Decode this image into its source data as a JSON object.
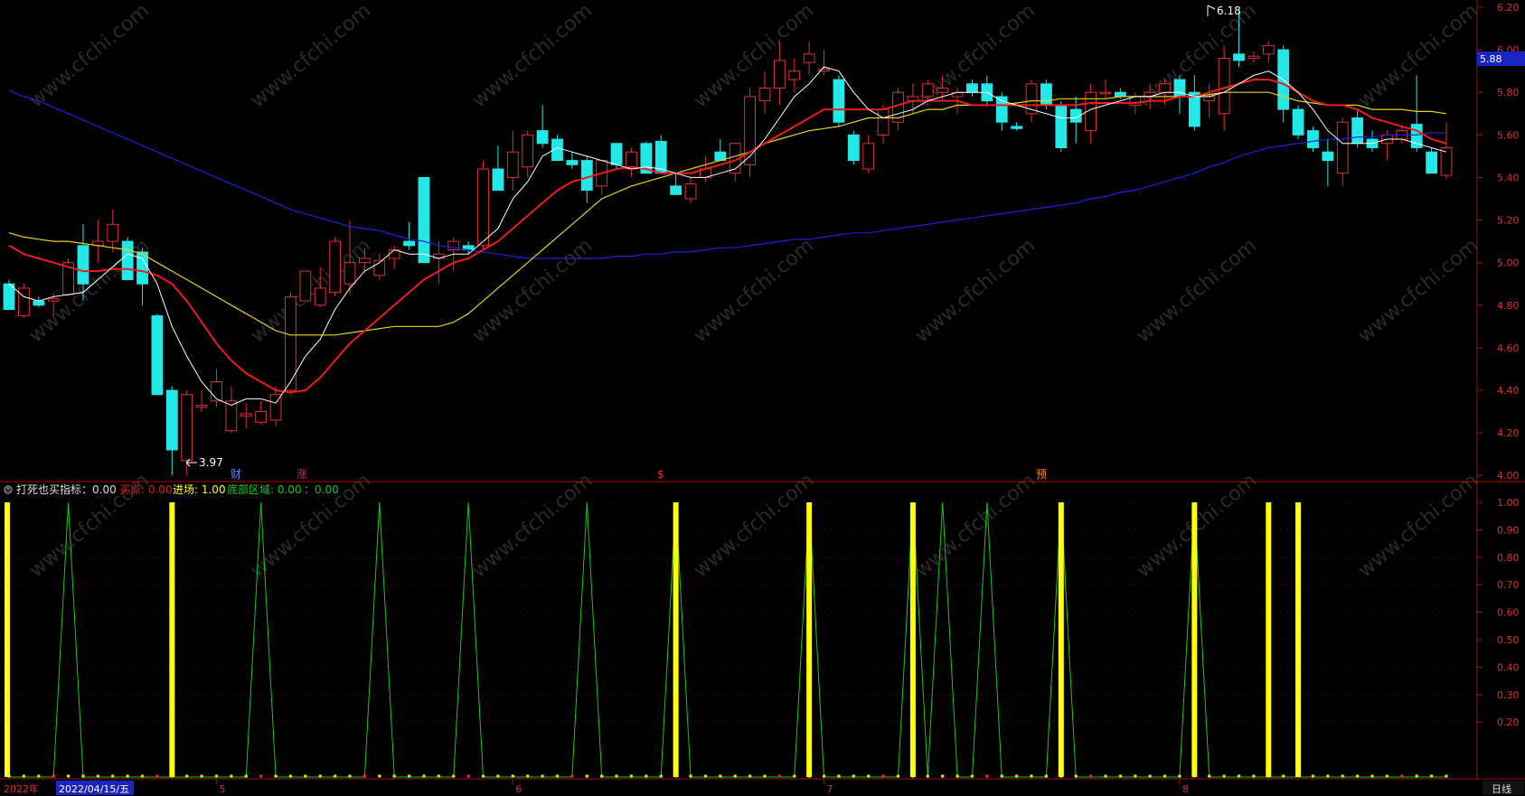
{
  "colors": {
    "background": "#000000",
    "axis": "#a01010",
    "up_candle": "#e03030",
    "down_candle": "#22e8e8",
    "ma5": "#ffffff",
    "ma10": "#ee1c1c",
    "ma20": "#e6d21a",
    "ma60": "#1a24d8",
    "signal_line": "#18c818",
    "entry_bar": "#ffff00",
    "price_tag_bg": "#1a24c0"
  },
  "header": {
    "indicator_title": "打死也买指标：0.00",
    "buy_label": "买点: 0.00",
    "entry_label": "进场: 1.00",
    "bottom_label": "底部区域: 0.00",
    "extra_label": "：0.00"
  },
  "price_axis_labels": [
    "6.00",
    "5.80",
    "5.60",
    "5.40",
    "5.20",
    "5.00",
    "4.80",
    "4.60",
    "4.40",
    "4.20",
    "4.00"
  ],
  "price_axis_top_partial": "6.20",
  "indicator_axis_labels": [
    "1.00",
    "0.90",
    "0.80",
    "0.70",
    "0.60",
    "0.50",
    "0.40",
    "0.30",
    "0.20"
  ],
  "current_price_tag": "5.88",
  "high_label": "6.18",
  "low_label": "3.97",
  "event_markers": [
    "财",
    "涨",
    "$",
    "预"
  ],
  "bottom_bar": {
    "year_label": "2022年",
    "date_label": "2022/04/15/五",
    "months": [
      "5",
      "6",
      "7",
      "8"
    ],
    "period_button": "日线"
  },
  "chart_data": {
    "type": "candlestick",
    "ylim": [
      3.95,
      6.2
    ],
    "y2lim": [
      0,
      1
    ],
    "candles": [
      [
        4.9,
        4.92,
        4.78,
        4.78
      ],
      [
        4.75,
        4.9,
        4.74,
        4.88
      ],
      [
        4.82,
        4.84,
        4.79,
        4.8
      ],
      [
        4.82,
        4.86,
        4.75,
        4.83
      ],
      [
        4.85,
        5.02,
        4.84,
        5.0
      ],
      [
        5.08,
        5.18,
        4.82,
        4.9
      ],
      [
        5.08,
        5.2,
        5.0,
        5.1
      ],
      [
        5.1,
        5.25,
        5.05,
        5.18
      ],
      [
        5.1,
        5.12,
        4.92,
        4.92
      ],
      [
        5.05,
        5.07,
        4.8,
        4.9
      ],
      [
        4.75,
        4.76,
        4.38,
        4.38
      ],
      [
        4.4,
        4.42,
        4.0,
        4.12
      ],
      [
        4.07,
        4.4,
        4.0,
        4.38
      ],
      [
        4.32,
        4.4,
        4.3,
        4.33
      ],
      [
        4.35,
        4.5,
        4.32,
        4.44
      ],
      [
        4.21,
        4.42,
        4.2,
        4.35
      ],
      [
        4.28,
        4.34,
        4.22,
        4.29
      ],
      [
        4.25,
        4.35,
        4.24,
        4.3
      ],
      [
        4.26,
        4.42,
        4.23,
        4.38
      ],
      [
        4.4,
        4.86,
        4.38,
        4.84
      ],
      [
        4.82,
        4.83,
        4.94,
        4.96
      ],
      [
        4.8,
        4.98,
        4.79,
        4.88
      ],
      [
        4.86,
        5.12,
        4.84,
        5.1
      ],
      [
        4.9,
        5.2,
        4.85,
        5.0
      ],
      [
        5.0,
        5.07,
        4.96,
        5.02
      ],
      [
        4.94,
        5.04,
        4.92,
        5.01
      ],
      [
        5.02,
        5.08,
        4.97,
        5.06
      ],
      [
        5.1,
        5.19,
        5.06,
        5.08
      ],
      [
        5.4,
        5.4,
        5.0,
        5.0
      ],
      [
        5.02,
        5.1,
        4.9,
        5.04
      ],
      [
        5.06,
        5.12,
        4.96,
        5.1
      ],
      [
        5.08,
        5.1,
        5.04,
        5.06
      ],
      [
        5.08,
        5.48,
        5.06,
        5.44
      ],
      [
        5.44,
        5.55,
        5.36,
        5.34
      ],
      [
        5.4,
        5.62,
        5.34,
        5.52
      ],
      [
        5.45,
        5.62,
        5.4,
        5.6
      ],
      [
        5.62,
        5.74,
        5.54,
        5.56
      ],
      [
        5.58,
        5.6,
        5.48,
        5.48
      ],
      [
        5.48,
        5.52,
        5.44,
        5.46
      ],
      [
        5.48,
        5.5,
        5.28,
        5.34
      ],
      [
        5.36,
        5.48,
        5.32,
        5.48
      ],
      [
        5.56,
        5.56,
        5.44,
        5.46
      ],
      [
        5.44,
        5.54,
        5.4,
        5.52
      ],
      [
        5.56,
        5.57,
        5.42,
        5.42
      ],
      [
        5.57,
        5.6,
        5.5,
        5.42
      ],
      [
        5.36,
        5.42,
        5.33,
        5.32
      ],
      [
        5.3,
        5.4,
        5.28,
        5.37
      ],
      [
        5.4,
        5.5,
        5.38,
        5.44
      ],
      [
        5.52,
        5.58,
        5.48,
        5.48
      ],
      [
        5.42,
        5.56,
        5.38,
        5.56
      ],
      [
        5.46,
        5.82,
        5.4,
        5.78
      ],
      [
        5.76,
        5.9,
        5.7,
        5.82
      ],
      [
        5.82,
        6.04,
        5.74,
        5.95
      ],
      [
        5.86,
        5.96,
        5.8,
        5.9
      ],
      [
        5.94,
        6.04,
        5.88,
        5.98
      ],
      [
        5.9,
        6.0,
        5.88,
        5.91
      ],
      [
        5.86,
        5.88,
        5.64,
        5.66
      ],
      [
        5.6,
        5.62,
        5.46,
        5.48
      ],
      [
        5.44,
        5.6,
        5.42,
        5.56
      ],
      [
        5.6,
        5.74,
        5.56,
        5.72
      ],
      [
        5.66,
        5.82,
        5.62,
        5.8
      ],
      [
        5.76,
        5.84,
        5.7,
        5.78
      ],
      [
        5.78,
        5.86,
        5.74,
        5.84
      ],
      [
        5.8,
        5.88,
        5.76,
        5.82
      ],
      [
        5.78,
        5.82,
        5.7,
        5.8
      ],
      [
        5.84,
        5.86,
        5.78,
        5.8
      ],
      [
        5.84,
        5.88,
        5.74,
        5.76
      ],
      [
        5.78,
        5.8,
        5.62,
        5.66
      ],
      [
        5.64,
        5.66,
        5.62,
        5.63
      ],
      [
        5.7,
        5.86,
        5.66,
        5.84
      ],
      [
        5.84,
        5.86,
        5.72,
        5.74
      ],
      [
        5.74,
        5.76,
        5.52,
        5.54
      ],
      [
        5.72,
        5.78,
        5.56,
        5.66
      ],
      [
        5.62,
        5.84,
        5.56,
        5.8
      ],
      [
        5.8,
        5.86,
        5.77,
        5.8
      ],
      [
        5.8,
        5.82,
        5.77,
        5.78
      ],
      [
        5.74,
        5.8,
        5.7,
        5.78
      ],
      [
        5.78,
        5.84,
        5.72,
        5.8
      ],
      [
        5.8,
        5.86,
        5.74,
        5.84
      ],
      [
        5.86,
        5.88,
        5.7,
        5.78
      ],
      [
        5.8,
        5.88,
        5.62,
        5.64
      ],
      [
        5.76,
        5.84,
        5.68,
        5.78
      ],
      [
        5.7,
        6.02,
        5.62,
        5.96
      ],
      [
        5.98,
        6.18,
        5.92,
        5.95
      ],
      [
        5.96,
        5.99,
        5.94,
        5.97
      ],
      [
        5.98,
        6.04,
        5.94,
        6.02
      ],
      [
        6.0,
        6.02,
        5.66,
        5.72
      ],
      [
        5.72,
        5.74,
        5.58,
        5.6
      ],
      [
        5.62,
        5.64,
        5.52,
        5.54
      ],
      [
        5.52,
        5.58,
        5.36,
        5.48
      ],
      [
        5.42,
        5.68,
        5.36,
        5.66
      ],
      [
        5.68,
        5.72,
        5.54,
        5.56
      ],
      [
        5.58,
        5.62,
        5.52,
        5.54
      ],
      [
        5.56,
        5.62,
        5.48,
        5.6
      ],
      [
        5.58,
        5.64,
        5.56,
        5.62
      ],
      [
        5.65,
        5.88,
        5.52,
        5.54
      ],
      [
        5.52,
        5.54,
        5.42,
        5.42
      ],
      [
        5.41,
        5.66,
        5.39,
        5.54
      ]
    ],
    "ma5": [
      4.9,
      4.84,
      4.82,
      4.84,
      4.85,
      4.86,
      4.92,
      4.98,
      5.04,
      5.02,
      4.9,
      4.7,
      4.56,
      4.44,
      4.36,
      4.33,
      4.36,
      4.36,
      4.34,
      4.44,
      4.56,
      4.64,
      4.78,
      4.88,
      4.96,
      5.0,
      5.06,
      5.04,
      5.04,
      5.02,
      5.04,
      5.04,
      5.1,
      5.16,
      5.3,
      5.38,
      5.5,
      5.54,
      5.52,
      5.5,
      5.48,
      5.46,
      5.44,
      5.45,
      5.44,
      5.42,
      5.4,
      5.4,
      5.42,
      5.44,
      5.5,
      5.58,
      5.68,
      5.78,
      5.84,
      5.92,
      5.9,
      5.8,
      5.72,
      5.68,
      5.7,
      5.72,
      5.76,
      5.78,
      5.8,
      5.8,
      5.8,
      5.76,
      5.74,
      5.72,
      5.7,
      5.68,
      5.68,
      5.72,
      5.74,
      5.76,
      5.78,
      5.78,
      5.8,
      5.8,
      5.78,
      5.78,
      5.8,
      5.84,
      5.88,
      5.9,
      5.86,
      5.8,
      5.72,
      5.62,
      5.56,
      5.56,
      5.56,
      5.58,
      5.58,
      5.56,
      5.54,
      5.52
    ],
    "ma10": [
      5.08,
      5.04,
      5.02,
      5.0,
      4.98,
      4.96,
      4.96,
      4.97,
      4.97,
      4.96,
      4.94,
      4.9,
      4.82,
      4.72,
      4.62,
      4.54,
      4.48,
      4.44,
      4.4,
      4.39,
      4.4,
      4.46,
      4.54,
      4.62,
      4.68,
      4.74,
      4.8,
      4.86,
      4.92,
      4.96,
      5.0,
      5.02,
      5.06,
      5.1,
      5.16,
      5.22,
      5.28,
      5.34,
      5.38,
      5.4,
      5.42,
      5.44,
      5.45,
      5.44,
      5.42,
      5.42,
      5.42,
      5.44,
      5.46,
      5.48,
      5.52,
      5.56,
      5.6,
      5.64,
      5.68,
      5.72,
      5.72,
      5.72,
      5.72,
      5.72,
      5.74,
      5.76,
      5.76,
      5.76,
      5.76,
      5.74,
      5.74,
      5.74,
      5.74,
      5.74,
      5.74,
      5.74,
      5.74,
      5.75,
      5.75,
      5.75,
      5.75,
      5.76,
      5.76,
      5.78,
      5.78,
      5.8,
      5.82,
      5.84,
      5.86,
      5.86,
      5.84,
      5.8,
      5.76,
      5.74,
      5.74,
      5.72,
      5.68,
      5.66,
      5.64,
      5.62,
      5.58,
      5.56
    ],
    "ma20": [
      5.14,
      5.12,
      5.11,
      5.1,
      5.1,
      5.09,
      5.08,
      5.07,
      5.06,
      5.04,
      5.0,
      4.96,
      4.92,
      4.88,
      4.84,
      4.8,
      4.76,
      4.72,
      4.68,
      4.66,
      4.66,
      4.66,
      4.66,
      4.67,
      4.68,
      4.69,
      4.7,
      4.7,
      4.7,
      4.7,
      4.72,
      4.76,
      4.82,
      4.88,
      4.94,
      5.0,
      5.06,
      5.12,
      5.18,
      5.24,
      5.3,
      5.33,
      5.36,
      5.38,
      5.4,
      5.42,
      5.44,
      5.46,
      5.48,
      5.5,
      5.52,
      5.56,
      5.58,
      5.6,
      5.62,
      5.63,
      5.64,
      5.66,
      5.68,
      5.68,
      5.68,
      5.7,
      5.72,
      5.72,
      5.74,
      5.74,
      5.74,
      5.74,
      5.75,
      5.76,
      5.76,
      5.77,
      5.77,
      5.77,
      5.77,
      5.78,
      5.78,
      5.78,
      5.78,
      5.78,
      5.78,
      5.79,
      5.8,
      5.8,
      5.8,
      5.8,
      5.78,
      5.76,
      5.75,
      5.74,
      5.74,
      5.74,
      5.72,
      5.72,
      5.72,
      5.71,
      5.71,
      5.7
    ],
    "ma60": [
      5.81,
      5.78,
      5.76,
      5.73,
      5.7,
      5.67,
      5.64,
      5.61,
      5.58,
      5.55,
      5.52,
      5.49,
      5.46,
      5.43,
      5.4,
      5.37,
      5.34,
      5.31,
      5.28,
      5.25,
      5.23,
      5.21,
      5.19,
      5.17,
      5.16,
      5.15,
      5.13,
      5.11,
      5.1,
      5.08,
      5.07,
      5.06,
      5.05,
      5.04,
      5.03,
      5.02,
      5.02,
      5.02,
      5.02,
      5.02,
      5.02,
      5.03,
      5.03,
      5.04,
      5.04,
      5.05,
      5.05,
      5.06,
      5.07,
      5.07,
      5.08,
      5.09,
      5.1,
      5.11,
      5.11,
      5.12,
      5.13,
      5.14,
      5.14,
      5.15,
      5.16,
      5.17,
      5.18,
      5.19,
      5.2,
      5.21,
      5.22,
      5.23,
      5.24,
      5.25,
      5.26,
      5.27,
      5.28,
      5.3,
      5.31,
      5.33,
      5.34,
      5.36,
      5.38,
      5.4,
      5.42,
      5.45,
      5.47,
      5.5,
      5.52,
      5.54,
      5.55,
      5.56,
      5.57,
      5.58,
      5.58,
      5.59,
      5.59,
      5.6,
      5.6,
      5.6,
      5.61,
      5.61
    ],
    "entry_signals": [
      0,
      11,
      45,
      54,
      61,
      71,
      80,
      85,
      87
    ],
    "signal_peaks": [
      4,
      17,
      25,
      31,
      39,
      45,
      54,
      61,
      63,
      66,
      71,
      80
    ]
  }
}
